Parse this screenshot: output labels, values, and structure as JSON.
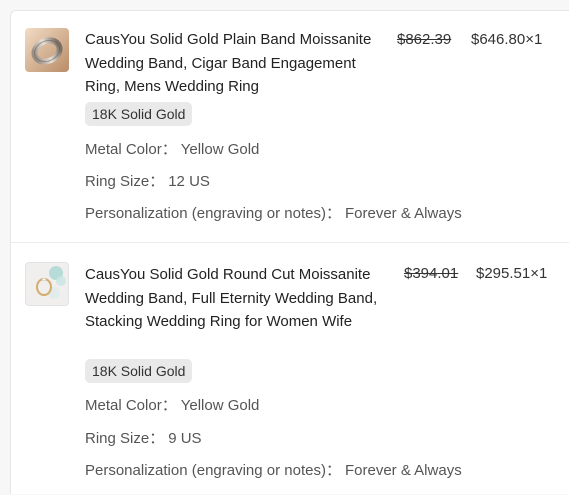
{
  "items": [
    {
      "title": "CausYou Solid Gold Plain Band Moissanite Wedding Band, Cigar Band Engagement Ring, Mens Wedding Ring",
      "original_price": "$862.39",
      "price_qty": "$646.80×1",
      "badge": "18K Solid Gold",
      "details": [
        {
          "label": "Metal Color",
          "value": "Yellow Gold"
        },
        {
          "label": "Ring Size",
          "value": "12 US"
        },
        {
          "label": "Personalization (engraving or notes)",
          "value": "Forever & Always"
        }
      ]
    },
    {
      "title": "CausYou Solid Gold Round Cut Moissanite Wedding Band, Full Eternity Wedding Band, Stacking Wedding Ring for Women Wife",
      "original_price": "$394.01",
      "price_qty": "$295.51×1",
      "badge": "18K Solid Gold",
      "details": [
        {
          "label": "Metal Color",
          "value": "Yellow Gold"
        },
        {
          "label": "Ring Size",
          "value": "9 US"
        },
        {
          "label": "Personalization (engraving or notes)",
          "value": "Forever & Always"
        }
      ]
    }
  ],
  "separator": "："
}
